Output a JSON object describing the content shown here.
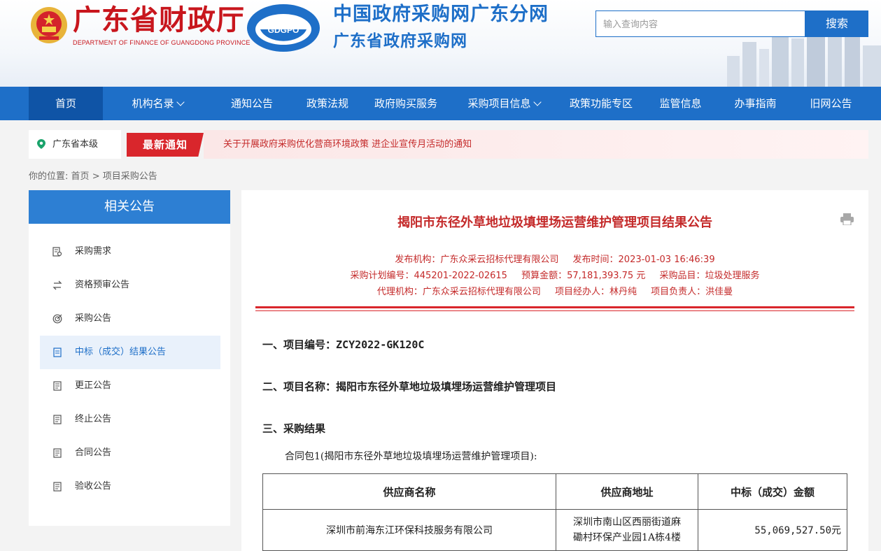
{
  "header": {
    "dept_cn": "广东省财政厅",
    "dept_en": "DEPARTMENT OF FINANCE OF GUANGDONG PROVINCE",
    "logo_text": "GDGPO",
    "site_title_1": "中国政府采购网广东分网",
    "site_title_2": "广东省政府采购网",
    "search_placeholder": "输入查询内容",
    "search_button": "搜索"
  },
  "nav": {
    "items": [
      {
        "label": "首页",
        "active": true,
        "dropdown": false
      },
      {
        "label": "机构名录",
        "dropdown": true
      },
      {
        "label": "通知公告",
        "dropdown": false
      },
      {
        "label": "政策法规",
        "dropdown": false
      },
      {
        "label": "政府购买服务",
        "dropdown": false
      },
      {
        "label": "采购项目信息",
        "dropdown": true
      },
      {
        "label": "政策功能专区",
        "dropdown": false
      },
      {
        "label": "监管信息",
        "dropdown": false
      },
      {
        "label": "办事指南",
        "dropdown": false
      },
      {
        "label": "旧网公告",
        "dropdown": false
      }
    ]
  },
  "notice": {
    "location": "广东省本级",
    "badge": "最新通知",
    "text": "关于开展政府采购优化营商环境政策 进企业宣传月活动的通知"
  },
  "breadcrumb": {
    "prefix": "你的位置:",
    "home": "首页",
    "sep": ">",
    "current": "项目采购公告"
  },
  "sidebar": {
    "title": "相关公告",
    "items": [
      {
        "label": "采购需求",
        "icon": "doc-search-icon"
      },
      {
        "label": "资格预审公告",
        "icon": "swap-icon"
      },
      {
        "label": "采购公告",
        "icon": "target-icon"
      },
      {
        "label": "中标（成交）结果公告",
        "icon": "doc-icon",
        "active": true
      },
      {
        "label": "更正公告",
        "icon": "doc-lines-icon"
      },
      {
        "label": "终止公告",
        "icon": "doc-lines-icon"
      },
      {
        "label": "合同公告",
        "icon": "doc-lines-icon"
      },
      {
        "label": "验收公告",
        "icon": "doc-lines-icon"
      }
    ]
  },
  "article": {
    "title": "揭阳市东径外草地垃圾填埋场运营维护管理项目结果公告",
    "meta_row1": [
      "发布机构：广东众采云招标代理有限公司",
      "发布时间：2023-01-03 16:46:39"
    ],
    "meta_row2": [
      "采购计划编号：445201-2022-02615",
      "预算金额：57,181,393.75 元",
      "采购品目：垃圾处理服务"
    ],
    "meta_row3": [
      "代理机构：广东众采云招标代理有限公司",
      "项目经办人：林丹纯",
      "项目负责人：洪佳曼"
    ],
    "sec1_label": "一、项目编号：",
    "sec1_value": "ZCY2022-GK120C",
    "sec2": "二、项目名称：揭阳市东径外草地垃圾填埋场运营维护管理项目",
    "sec3": "三、采购结果",
    "package": "合同包1(揭阳市东径外草地垃圾填埋场运营维护管理项目):",
    "table": {
      "headers": [
        "供应商名称",
        "供应商地址",
        "中标（成交）金额"
      ],
      "rows": [
        {
          "name": "深圳市前海东江环保科技服务有限公司",
          "address_line1": "深圳市南山区西丽街道麻",
          "address_line2": "磡村环保产业园1A栋4楼",
          "amount": "55,069,527.50元"
        }
      ]
    }
  },
  "colors": {
    "primary": "#1e6fc8",
    "nav_active": "#0f54a6",
    "accent_red": "#c42a2a",
    "badge_red": "#d9262c"
  }
}
